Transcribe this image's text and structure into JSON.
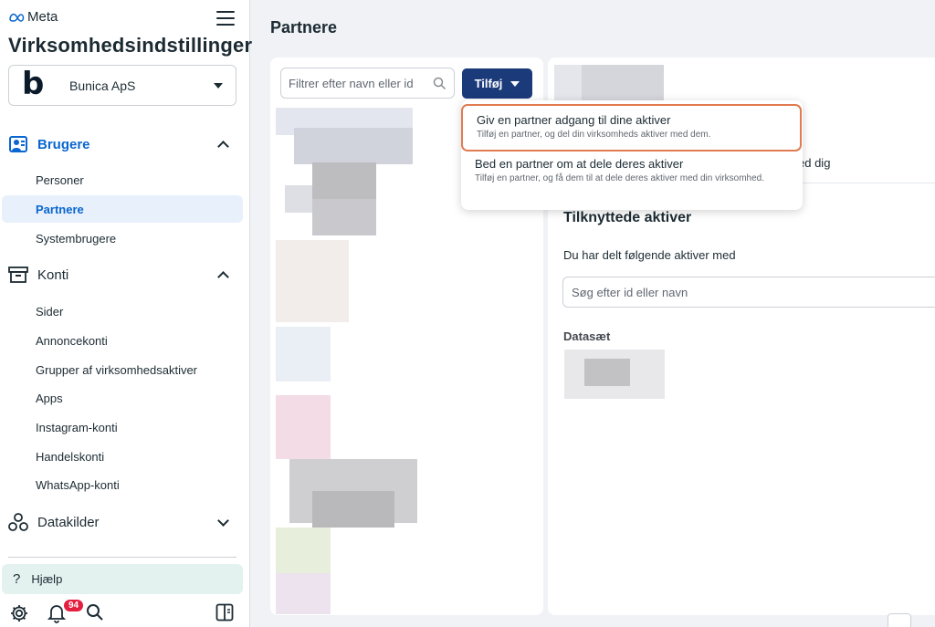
{
  "brand": {
    "name": "Meta"
  },
  "app": {
    "title": "Virksomhedsindstillinger"
  },
  "business": {
    "logo_letter": "b",
    "name": "Bunica ApS"
  },
  "sidebar": {
    "sections": [
      {
        "label": "Brugere",
        "icon": "users-icon",
        "expanded": true,
        "active": true
      },
      {
        "label": "Konti",
        "icon": "archive-box-icon",
        "expanded": true,
        "active": false
      },
      {
        "label": "Datakilder",
        "icon": "data-sources-icon",
        "expanded": false,
        "active": false
      }
    ],
    "users_items": [
      "Personer",
      "Partnere",
      "Systembrugere"
    ],
    "accounts_items": [
      "Sider",
      "Annoncekonti",
      "Grupper af virksomhedsaktiver",
      "Apps",
      "Instagram-konti",
      "Handelskonti",
      "WhatsApp-konti"
    ],
    "selected_item": "Partnere",
    "help_label": "Hjælp",
    "notifications_count": "94"
  },
  "main": {
    "title": "Partnere",
    "search_placeholder": "Filtrer efter navn eller id",
    "add_button": "Tilføj",
    "dropdown": [
      {
        "title": "Giv en partner adgang til dine aktiver",
        "subtitle": "Tilføj en partner, og del din virksomheds aktiver med dem.",
        "highlighted": true
      },
      {
        "title": "Bed en partner om at dele deres aktiver",
        "subtitle": "Tilføj en partner, og få dem til at dele deres aktiver med din virksomhed.",
        "highlighted": false
      }
    ],
    "detail": {
      "partial_text": "ed dig",
      "assets_title": "Tilknyttede aktiver",
      "assets_desc": "Du har delt følgende aktiver med",
      "assets_search_placeholder": "Søg efter id eller navn",
      "dataset_label": "Datasæt"
    }
  },
  "colors": {
    "accent": "#0a66d0",
    "button": "#1b3a7a",
    "highlight_border": "#e07b52",
    "help_bg": "#e3f1ef",
    "badge": "#e41e3f"
  }
}
